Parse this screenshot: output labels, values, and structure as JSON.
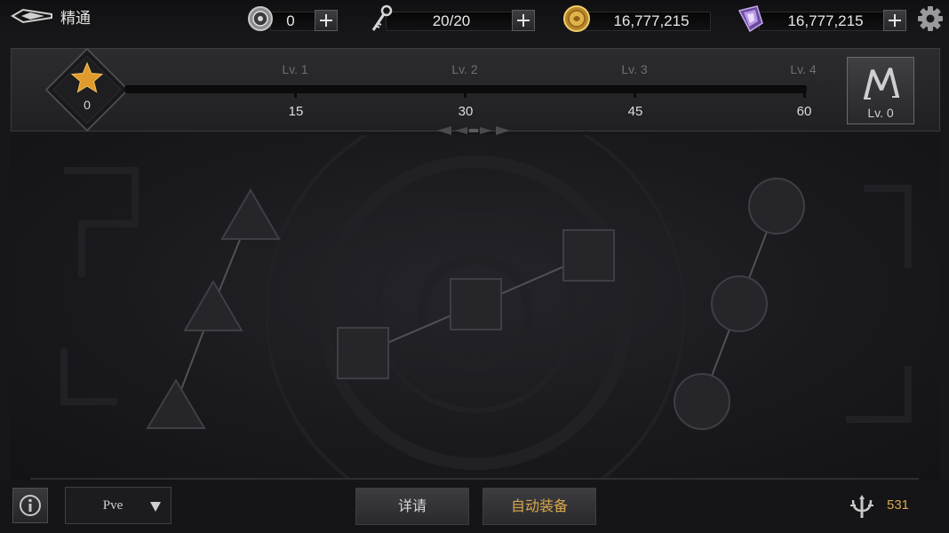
{
  "header": {
    "title": "精通",
    "back_icon": "winged-back-arrow-icon",
    "resources": [
      {
        "icon": "silver-medal-icon",
        "value": "0"
      },
      {
        "icon": "key-icon",
        "value": "20/20"
      },
      {
        "icon": "gold-coin-icon",
        "value": "16,777,215"
      },
      {
        "icon": "purple-crystal-icon",
        "value": "16,777,215"
      }
    ],
    "settings_icon": "gear-icon"
  },
  "mastery": {
    "star_points": "0",
    "levels": [
      {
        "label": "Lv. 1",
        "required": "15"
      },
      {
        "label": "Lv. 2",
        "required": "30"
      },
      {
        "label": "Lv. 3",
        "required": "45"
      },
      {
        "label": "Lv. 4",
        "required": "60"
      }
    ],
    "progress_fraction": 0,
    "rank": {
      "label": "Lv. 0",
      "icon": "rune-emblem-icon"
    }
  },
  "skill_tree": {
    "branches": [
      {
        "shape": "triangle",
        "node_count": 3
      },
      {
        "shape": "square",
        "node_count": 3
      },
      {
        "shape": "circle",
        "node_count": 3
      }
    ]
  },
  "footer": {
    "info_icon": "info-icon",
    "mode_selected": "Pve",
    "detail_label": "详请",
    "auto_equip_label": "自动装备",
    "power_icon": "trident-icon",
    "power_value": "531"
  },
  "colors": {
    "accent_gold": "#d8a94c",
    "star_orange": "#e09a2c",
    "node_fill": "#26262a",
    "node_stroke": "#3e3e44"
  }
}
